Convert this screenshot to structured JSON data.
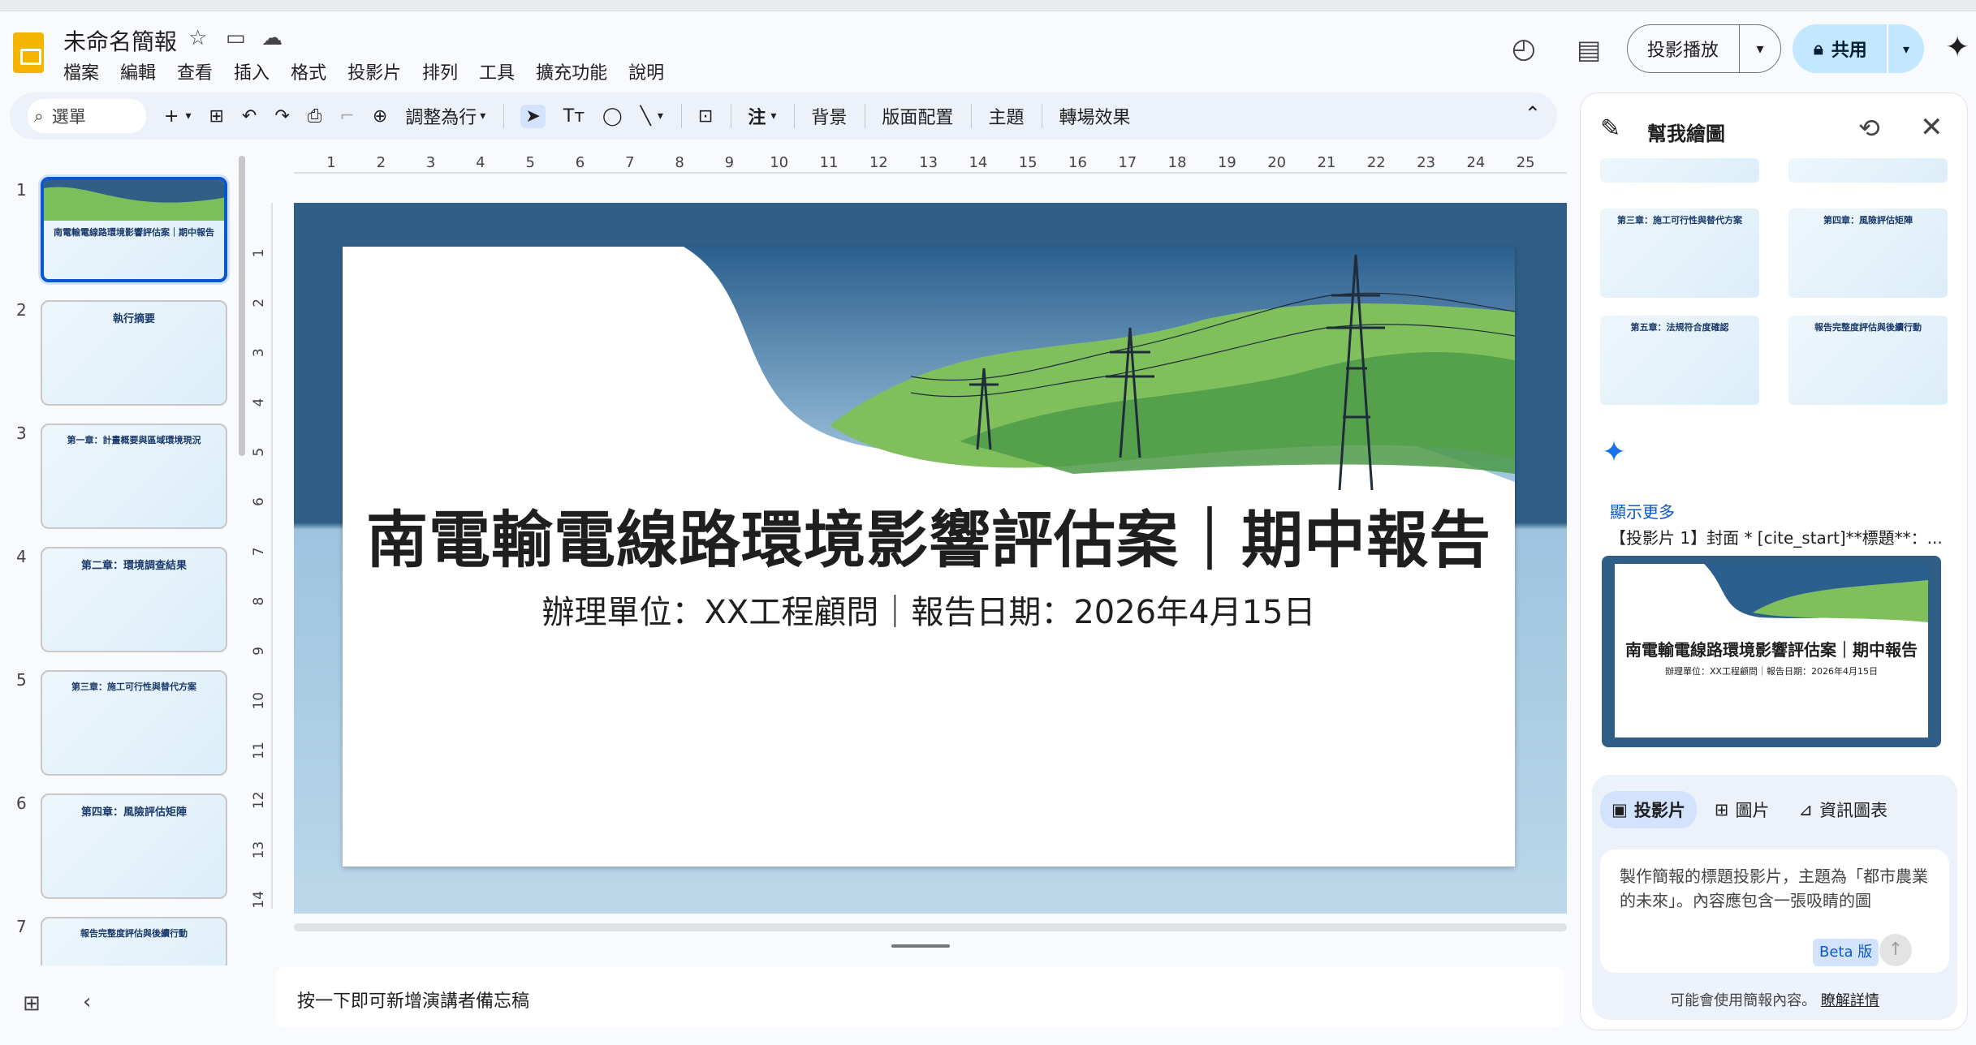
{
  "app": {
    "doc_title": "未命名簡報",
    "menu": [
      "檔案",
      "編輯",
      "查看",
      "插入",
      "格式",
      "投影片",
      "排列",
      "工具",
      "擴充功能",
      "說明"
    ],
    "slideshow_label": "投影播放",
    "share_label": "共用",
    "accent": "#0b57d0",
    "share_bg": "#c2e7ff"
  },
  "toolbar": {
    "search_label": "選單",
    "zoom_label": "調整為行",
    "annotate_label": "注",
    "background_label": "背景",
    "layout_label": "版面配置",
    "theme_label": "主題",
    "transition_label": "轉場效果"
  },
  "filmstrip": {
    "slides": [
      {
        "num": "1",
        "title": "南電輸電線路環境影響評估案｜期中報告"
      },
      {
        "num": "2",
        "title": "執行摘要"
      },
      {
        "num": "3",
        "title": "第一章：計畫概要與區域環境現況"
      },
      {
        "num": "4",
        "title": "第二章：環境調查結果"
      },
      {
        "num": "5",
        "title": "第三章：施工可行性與替代方案"
      },
      {
        "num": "6",
        "title": "第四章：風險評估矩陣"
      },
      {
        "num": "7",
        "title": "報告完整度評估與後續行動"
      }
    ]
  },
  "ruler": {
    "top": [
      "1",
      "2",
      "3",
      "4",
      "5",
      "6",
      "7",
      "8",
      "9",
      "10",
      "11",
      "12",
      "13",
      "14",
      "15",
      "16",
      "17",
      "18",
      "19",
      "20",
      "21",
      "22",
      "23",
      "24",
      "25"
    ],
    "left": [
      "1",
      "2",
      "3",
      "4",
      "5",
      "6",
      "7",
      "8",
      "9",
      "10",
      "11",
      "12",
      "13",
      "14"
    ]
  },
  "slide": {
    "title": "南電輸電線路環境影響評估案｜期中報告",
    "subtitle": "辦理單位：XX工程顧問｜報告日期：2026年4月15日"
  },
  "notes": {
    "placeholder": "按一下即可新增演講者備忘稿"
  },
  "panel": {
    "title": "幫我繪圖",
    "thumbs": [
      {
        "title": "第三章：施工可行性與替代方案"
      },
      {
        "title": "第四章：風險評估矩陣"
      },
      {
        "title": "第五章：法規符合度確認"
      },
      {
        "title": "報告完整度評估與後續行動"
      }
    ],
    "show_more": "顯示更多",
    "prompt_echo": "【投影片 1】封面 * [cite_start]**標題**：...",
    "result_title": "南電輸電線路環境影響評估案｜期中報告",
    "result_subtitle": "辦理單位：XX工程顧問｜報告日期：2026年4月15日",
    "tabs": [
      "投影片",
      "圖片",
      "資訊圖表"
    ],
    "prompt_placeholder": "製作簡報的標題投影片，主題為「都市農業的未來」。內容應包含一張吸睛的圖",
    "beta": "Beta 版",
    "footer_text": "可能會使用簡報內容。",
    "footer_link": "瞭解詳情"
  }
}
